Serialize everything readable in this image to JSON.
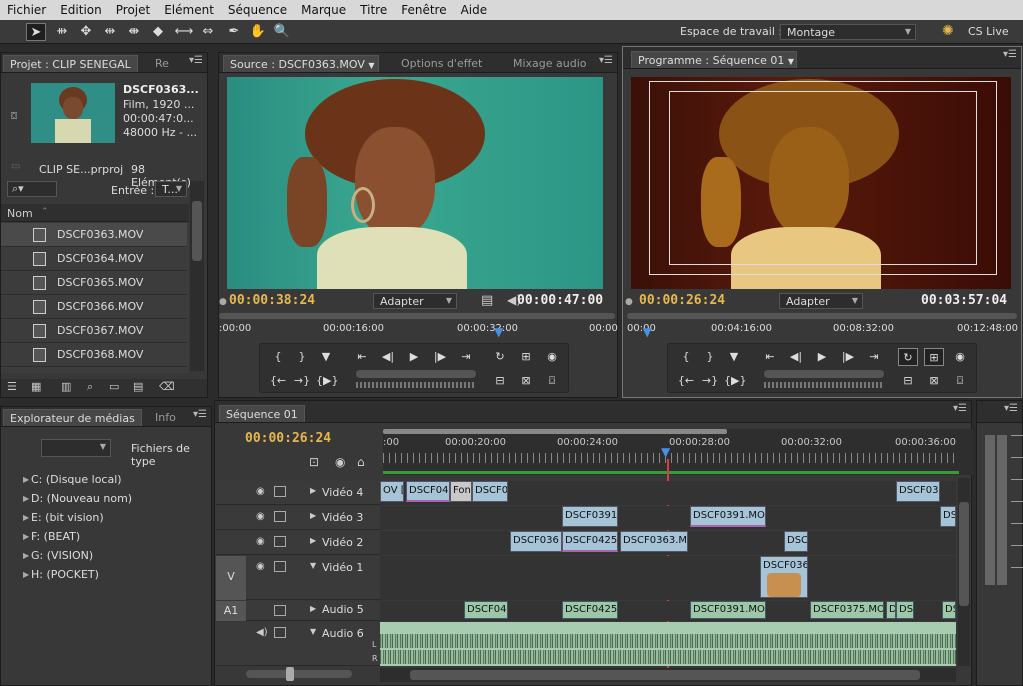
{
  "menu": [
    "Fichier",
    "Edition",
    "Projet",
    "Elément",
    "Séquence",
    "Marque",
    "Titre",
    "Fenêtre",
    "Aide"
  ],
  "workspace": {
    "label": "Espace de travail :",
    "value": "Montage",
    "cslive": "CS Live"
  },
  "project": {
    "tabs": [
      "Projet : CLIP SENEGAL",
      "Re"
    ],
    "clip_name": "DSCF0363...",
    "clip_info": [
      "Film, 1920 ...",
      "00:00:47:0...",
      "48000 Hz - ..."
    ],
    "project_file": "CLIP SE...prproj",
    "count": "98 Elément(s)",
    "entry_label": "Entrée :",
    "entry_value": "T...",
    "column": "Nom",
    "files": [
      "DSCF0363.MOV",
      "DSCF0364.MOV",
      "DSCF0365.MOV",
      "DSCF0366.MOV",
      "DSCF0367.MOV",
      "DSCF0368.MOV"
    ]
  },
  "source": {
    "tabs": [
      "Source : DSCF0363.MOV",
      "Options d'effet",
      "Mixage audio"
    ],
    "timecode_current": "00:00:38:24",
    "timecode_duration": "00:00:47:00",
    "fit": "Adapter",
    "ruler": [
      ":00:00",
      "00:00:16:00",
      "00:00:32:00",
      "00:00"
    ],
    "playhead_fraction": 0.71
  },
  "program": {
    "tabs": [
      "Programme : Séquence 01"
    ],
    "timecode_current": "00:00:26:24",
    "timecode_duration": "00:03:57:04",
    "fit": "Adapter",
    "ruler": [
      "00:00",
      "00:04:16:00",
      "00:08:32:00",
      "00:12:48:00"
    ],
    "playhead_fraction": 0.04
  },
  "media": {
    "tabs": [
      "Explorateur de médias",
      "Info"
    ],
    "filetypes_label": "Fichiers de type",
    "drives": [
      "C: (Disque local)",
      "D: (Nouveau nom)",
      "E: (bit vision)",
      "F: (BEAT)",
      "G: (VISION)",
      "H: (POCKET)"
    ]
  },
  "sequence": {
    "tab": "Séquence 01",
    "timecode": "00:00:26:24",
    "ruler": [
      ":00",
      "00:00:20:00",
      "00:00:24:00",
      "00:00:28:00",
      "00:00:32:00",
      "00:00:36:00"
    ],
    "tracks": [
      "Vidéo 4",
      "Vidéo 3",
      "Vidéo 2",
      "Vidéo 1",
      "Audio 5",
      "Audio 6"
    ],
    "target_v": "V",
    "target_a": "A1",
    "clips_v4": [
      "OV [",
      "DSCF04",
      "Fon",
      "DSCF0",
      "DSCF03"
    ],
    "clips_v3": [
      "DSCF0391",
      "DSCF0391.MO'",
      "DS"
    ],
    "clips_v2": [
      "DSCF036",
      "DSCF0425",
      "DSCF0363.M",
      "DSC"
    ],
    "clips_v1": [
      "DSCF036"
    ],
    "clips_a5": [
      "DSCF04",
      "DSCF0425",
      "DSCF0391.MO'",
      "DSCF0375.MO",
      "D",
      "DS",
      "DS"
    ],
    "audio_lr": [
      "L",
      "R"
    ]
  },
  "colors": {
    "timecode": "#e8b84c",
    "playhead": "#d04040",
    "clip_video": "#a6c4d8",
    "clip_audio": "#9cc8a8"
  }
}
